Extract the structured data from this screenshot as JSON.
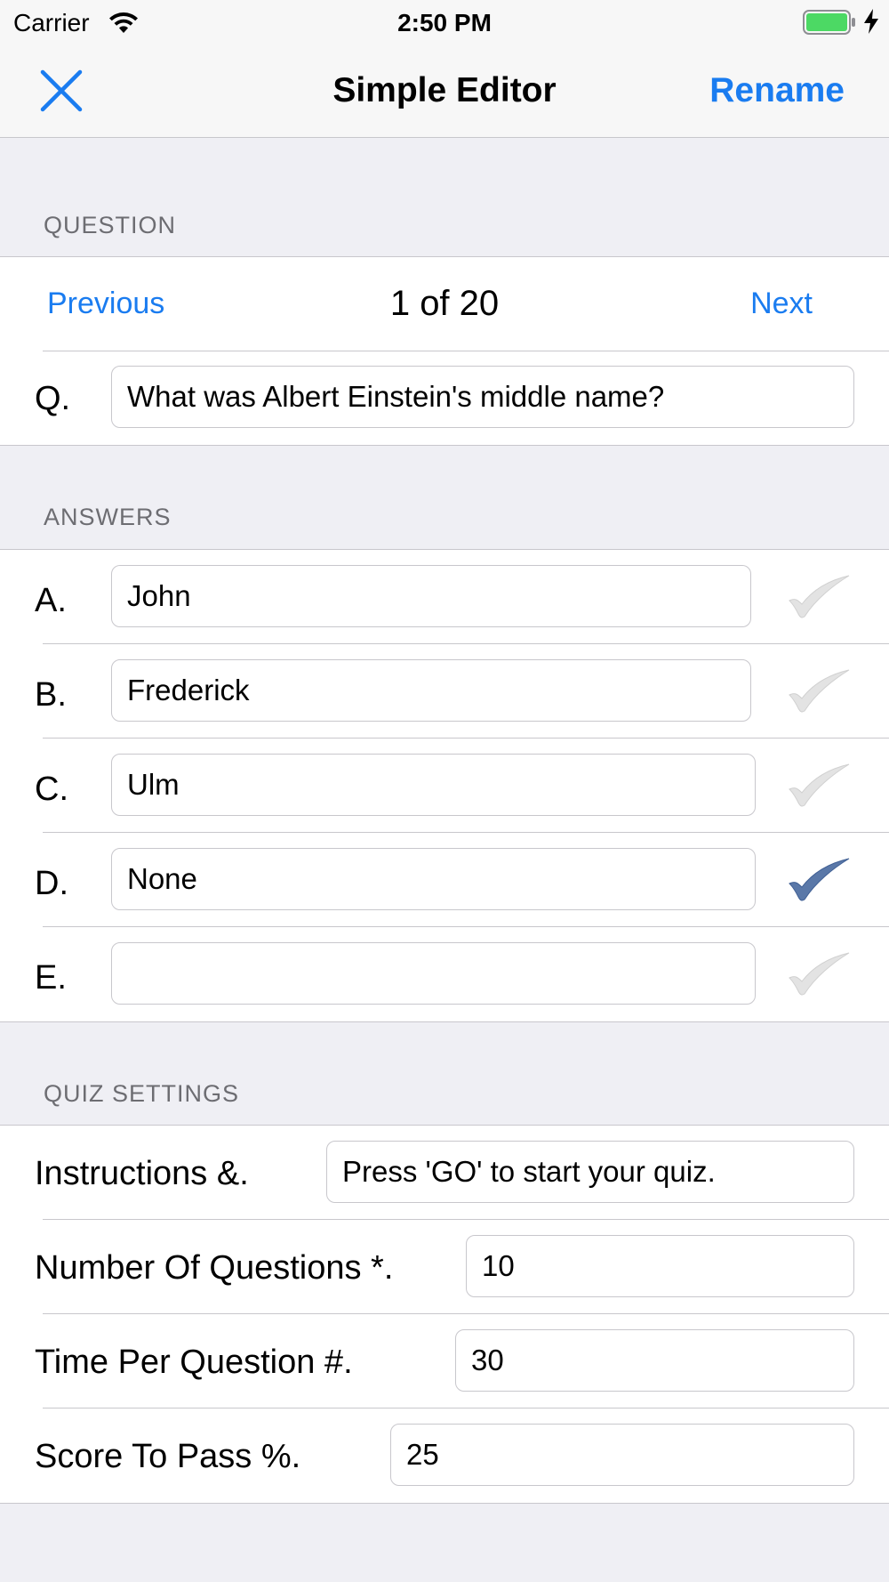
{
  "status_bar": {
    "carrier": "Carrier",
    "time": "2:50 PM",
    "battery_color": "#4cd964"
  },
  "nav": {
    "close_icon": "close-x-icon",
    "title": "Simple Editor",
    "rename_label": "Rename",
    "accent_color": "#1a7cf0"
  },
  "question_section": {
    "header": "QUESTION",
    "previous_label": "Previous",
    "counter": "1 of 20",
    "next_label": "Next",
    "q_label": "Q.",
    "q_value": "What was Albert Einstein's middle name?"
  },
  "answers_section": {
    "header": "ANSWERS",
    "answers": [
      {
        "label": "A.",
        "value": "John",
        "correct": false
      },
      {
        "label": "B.",
        "value": "Frederick",
        "correct": false
      },
      {
        "label": "C.",
        "value": "Ulm",
        "correct": false
      },
      {
        "label": "D.",
        "value": "None",
        "correct": true
      },
      {
        "label": "E.",
        "value": "",
        "correct": false
      }
    ]
  },
  "settings_section": {
    "header": "QUIZ SETTINGS",
    "instructions_label": "Instructions &.",
    "instructions_value": "Press 'GO' to start your quiz.",
    "num_questions_label": "Number Of Questions *.",
    "num_questions_value": "10",
    "time_per_question_label": "Time Per Question #.",
    "time_per_question_value": "30",
    "score_to_pass_label": "Score To Pass %.",
    "score_to_pass_value": "25"
  }
}
